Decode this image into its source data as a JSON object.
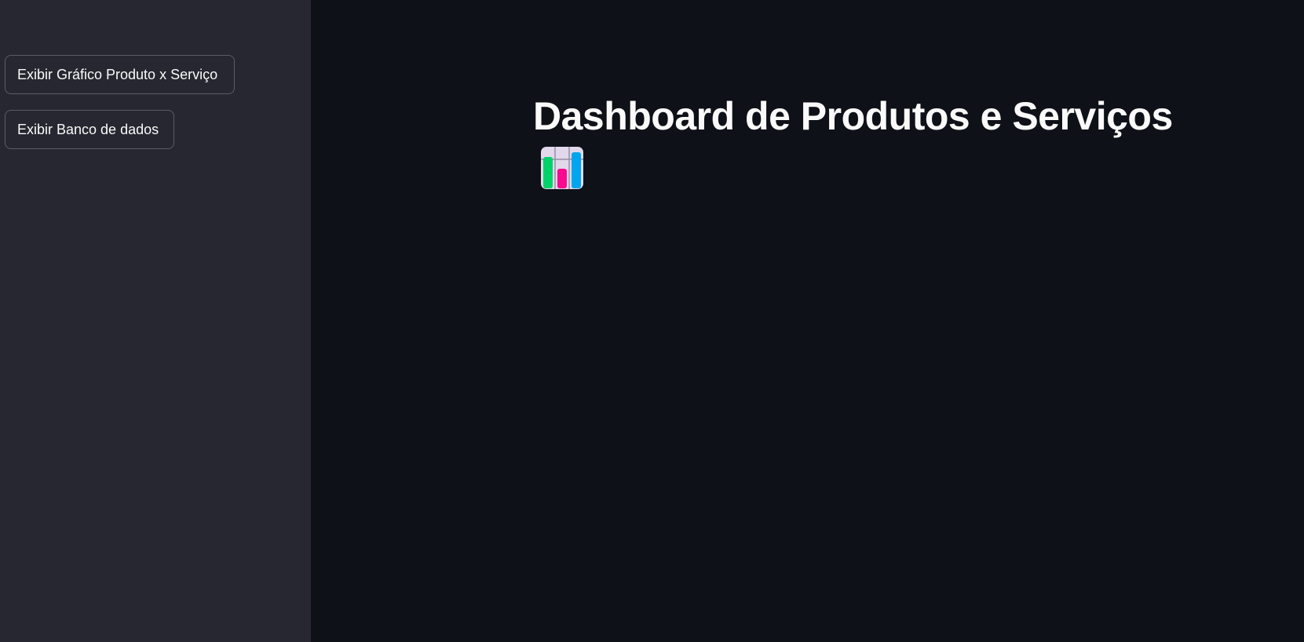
{
  "sidebar": {
    "buttons": [
      {
        "label": "Exibir Gráfico Produto x Serviço"
      },
      {
        "label": "Exibir Banco de dados"
      }
    ]
  },
  "main": {
    "title": "Dashboard de Produtos e Serviços",
    "title_icon": "bar-chart-emoji-icon"
  },
  "colors": {
    "sidebar_bg": "#262730",
    "main_bg": "#0e1117",
    "text": "#fafafa",
    "button_border": "rgba(250,250,250,0.25)",
    "icon_green": "#00d26a",
    "icon_pink": "#f70a8d",
    "icon_blue": "#00a6ed",
    "icon_bg": "#e1d8ec"
  }
}
